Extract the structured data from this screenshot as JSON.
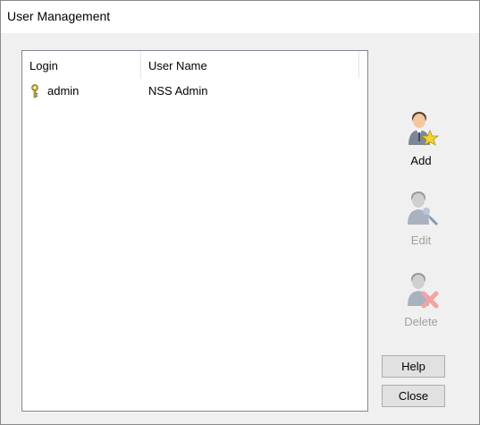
{
  "window": {
    "title": "User Management"
  },
  "users_list": {
    "columns": [
      "Login",
      "User Name"
    ],
    "rows": [
      {
        "login": "admin",
        "user_name": "NSS Admin",
        "icon": "key-icon"
      }
    ]
  },
  "actions": {
    "add_label": "Add",
    "edit_label": "Edit",
    "delete_label": "Delete",
    "help_label": "Help",
    "close_label": "Close"
  },
  "icons": {
    "add": "user-add-icon",
    "edit": "user-edit-icon",
    "delete": "user-delete-icon"
  },
  "colors": {
    "disabled_text": "#a0a0a0",
    "button_face": "#e1e1e1",
    "window_bg": "#f0f0f0"
  }
}
